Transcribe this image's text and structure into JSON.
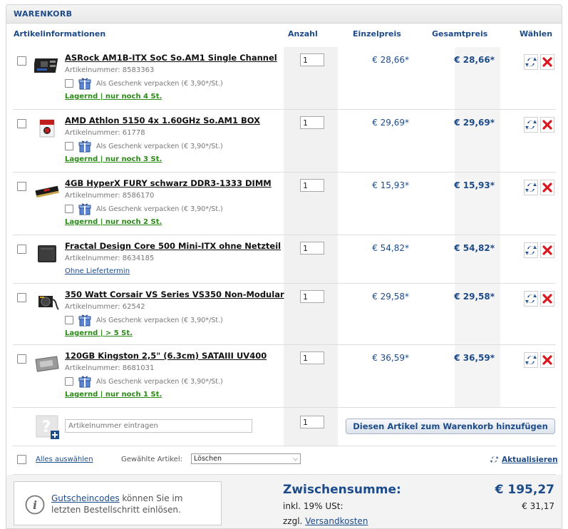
{
  "cart": {
    "title": "WARENKORB",
    "headers": {
      "info": "Artikelinformationen",
      "qty": "Anzahl",
      "unit": "Einzelpreis",
      "total": "Gesamtpreis",
      "select": "Wählen"
    },
    "items": [
      {
        "name": "ASRock AM1B-ITX SoC So.AM1 Single Channel",
        "artnr": "Artikelnummer: 8583363",
        "gift": "Als Geschenk verpacken (€ 3,90*/St.)",
        "stock": "Lagernd | nur noch 4 St.",
        "qty": "1",
        "unit": "€ 28,66*",
        "total": "€ 28,66*"
      },
      {
        "name": "AMD Athlon 5150 4x 1.60GHz So.AM1 BOX",
        "artnr": "Artikelnummer: 61778",
        "gift": "Als Geschenk verpacken (€ 3,90*/St.)",
        "stock": "Lagernd | nur noch 3 St.",
        "qty": "1",
        "unit": "€ 29,69*",
        "total": "€ 29,69*"
      },
      {
        "name": "4GB HyperX FURY schwarz DDR3-1333 DIMM",
        "artnr": "Artikelnummer: 8586170",
        "gift": "Als Geschenk verpacken (€ 3,90*/St.)",
        "stock": "Lagernd | nur noch 2 St.",
        "qty": "1",
        "unit": "€ 15,93*",
        "total": "€ 15,93*"
      },
      {
        "name": "Fractal Design Core 500 Mini-ITX ohne Netzteil",
        "artnr": "Artikelnummer: 8634185",
        "gift": "",
        "stock": "Ohne Liefertermin",
        "qty": "1",
        "unit": "€ 54,82*",
        "total": "€ 54,82*"
      },
      {
        "name": "350 Watt Corsair VS Series VS350 Non-Modular",
        "artnr": "Artikelnummer: 62542",
        "gift": "Als Geschenk verpacken (€ 3,90*/St.)",
        "stock": "Lagernd | > 5 St.",
        "qty": "1",
        "unit": "€ 29,58*",
        "total": "€ 29,58*"
      },
      {
        "name": "120GB Kingston 2,5\" (6.3cm) SATAIII UV400",
        "artnr": "Artikelnummer: 8681031",
        "gift": "Als Geschenk verpacken (€ 3,90*/St.)",
        "stock": "Lagernd | nur noch 1 St.",
        "qty": "1",
        "unit": "€ 36,59*",
        "total": "€ 36,59*"
      }
    ],
    "add": {
      "placeholder": "Artikelnummer eintragen",
      "qty": "1",
      "button": "Diesen Artikel zum Warenkorb hinzufügen"
    },
    "bar": {
      "select_all": "Alles auswählen",
      "selected_label": "Gewählte Artikel:",
      "action": "Löschen",
      "update": "Aktualisieren"
    },
    "summary": {
      "voucher_link": "Gutscheincodes",
      "voucher_text": " können Sie im letzten Bestellschritt einlösen.",
      "subtotal_label": "Zwischensumme:",
      "subtotal": "€ 195,27",
      "tax_label": "inkl. 19% USt:",
      "tax": "€ 31,17",
      "shipping_prefix": "zzgl. ",
      "shipping_link": "Versandkosten"
    }
  },
  "colors": {
    "accent": "#1d4b89",
    "stock_green": "#2a8a16",
    "delete_red": "#d9181f"
  }
}
